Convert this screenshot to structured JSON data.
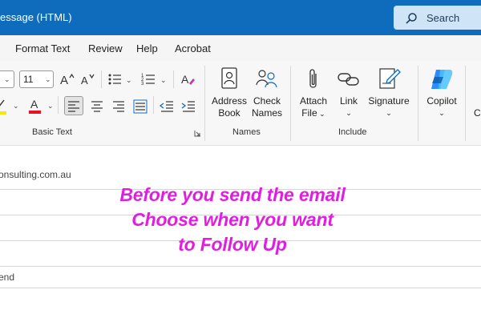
{
  "titlebar": {
    "title": "essage (HTML)",
    "search_label": "Search"
  },
  "tabs": [
    "Format Text",
    "Review",
    "Help",
    "Acrobat"
  ],
  "ribbon": {
    "font_size": "11",
    "groups": {
      "basic_text": "Basic Text",
      "names": "Names",
      "include": "Include"
    },
    "buttons": {
      "address_book": [
        "Address",
        "Book"
      ],
      "check_names": [
        "Check",
        "Names"
      ],
      "attach_file": [
        "Attach",
        "File"
      ],
      "link": "Link",
      "signature": "Signature",
      "copilot": "Copilot",
      "cut_off": "C"
    },
    "colors": {
      "font_color": "#e81123",
      "highlight": "#ffe500",
      "copilot_blue": "#2d8cff"
    }
  },
  "message": {
    "to_fragment": "onsulting.com.au",
    "subject_fragment": "end"
  },
  "overlay": {
    "lines": [
      "Before you send the email",
      "Choose when you want",
      "to Follow Up"
    ],
    "color": "#e11de0"
  }
}
